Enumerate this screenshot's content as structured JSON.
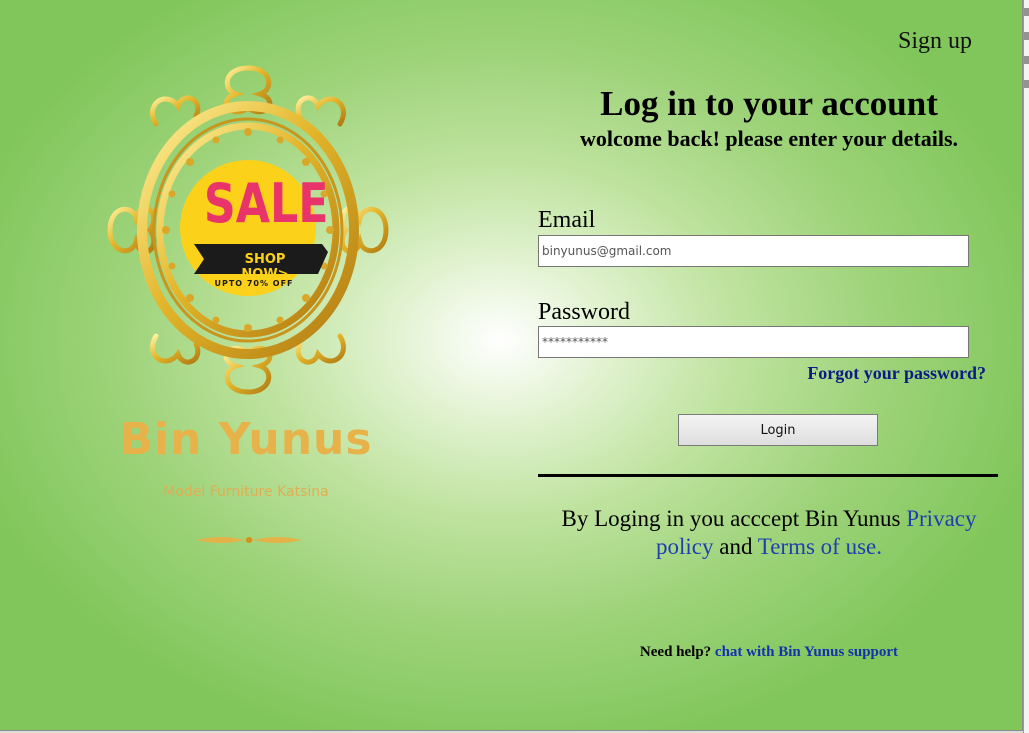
{
  "header": {
    "signup_label": "Sign up"
  },
  "login": {
    "title": "Log in to your account",
    "subtitle": "wolcome back! please enter your details.",
    "email_label": "Email",
    "email_value": "binyunus@gmail.com",
    "password_label": "Password",
    "password_value": "***********",
    "forgot_label": "Forgot your password?",
    "login_button": "Login"
  },
  "terms": {
    "prefix": "By Loging in you acccept Bin Yunus ",
    "privacy_link": "Privacy policy",
    "middle": " and ",
    "terms_link": "Terms of use."
  },
  "help": {
    "prefix": "Need help? ",
    "support_link": "chat with Bin Yunus support"
  },
  "brand": {
    "sale_text": "SALE",
    "shop_now": "SHOP NOW>",
    "upto_text": "UPTO 70% OFF",
    "name": "Bin Yunus",
    "tagline": "Model Furniture Katsina"
  },
  "colors": {
    "background_green": "#80c65a",
    "gold": "#e8b24a",
    "sale_yellow": "#fcd11a",
    "sale_pink": "#e8336b",
    "link_blue": "#1f3fb0",
    "forgot_navy": "#0a1a86"
  }
}
